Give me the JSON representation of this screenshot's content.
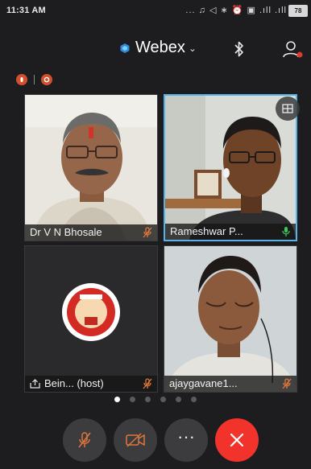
{
  "status_bar": {
    "time": "11:31 AM",
    "indicators": "... ♫ ◁ ∗ ⏰ ▣ .ıll .ıll",
    "battery": "78"
  },
  "header": {
    "app_name": "Webex",
    "icons": [
      "webex-logo-icon",
      "chevron-down-icon",
      "bluetooth-icon",
      "participants-icon"
    ]
  },
  "recording_icons": [
    "recording-icon",
    "recording-icon"
  ],
  "participants": [
    {
      "name": "Dr V N Bhosale",
      "muted": true
    },
    {
      "name": "Rameshwar P...",
      "muted": false,
      "active_speaker": true
    },
    {
      "name": "Bein... (host)",
      "muted": true,
      "sharing": true
    },
    {
      "name": "ajaygavane1...",
      "muted": true
    }
  ],
  "pager": {
    "pages": 6,
    "current": 1
  },
  "controls": [
    "mute-button",
    "video-button",
    "more-button",
    "end-call-button"
  ],
  "colors": {
    "background": "#1d1d1f",
    "active_border": "#56b2e8",
    "end_call": "#f2332b",
    "unmuted_mic": "#39c65a",
    "muted_mic": "#e0773a"
  }
}
